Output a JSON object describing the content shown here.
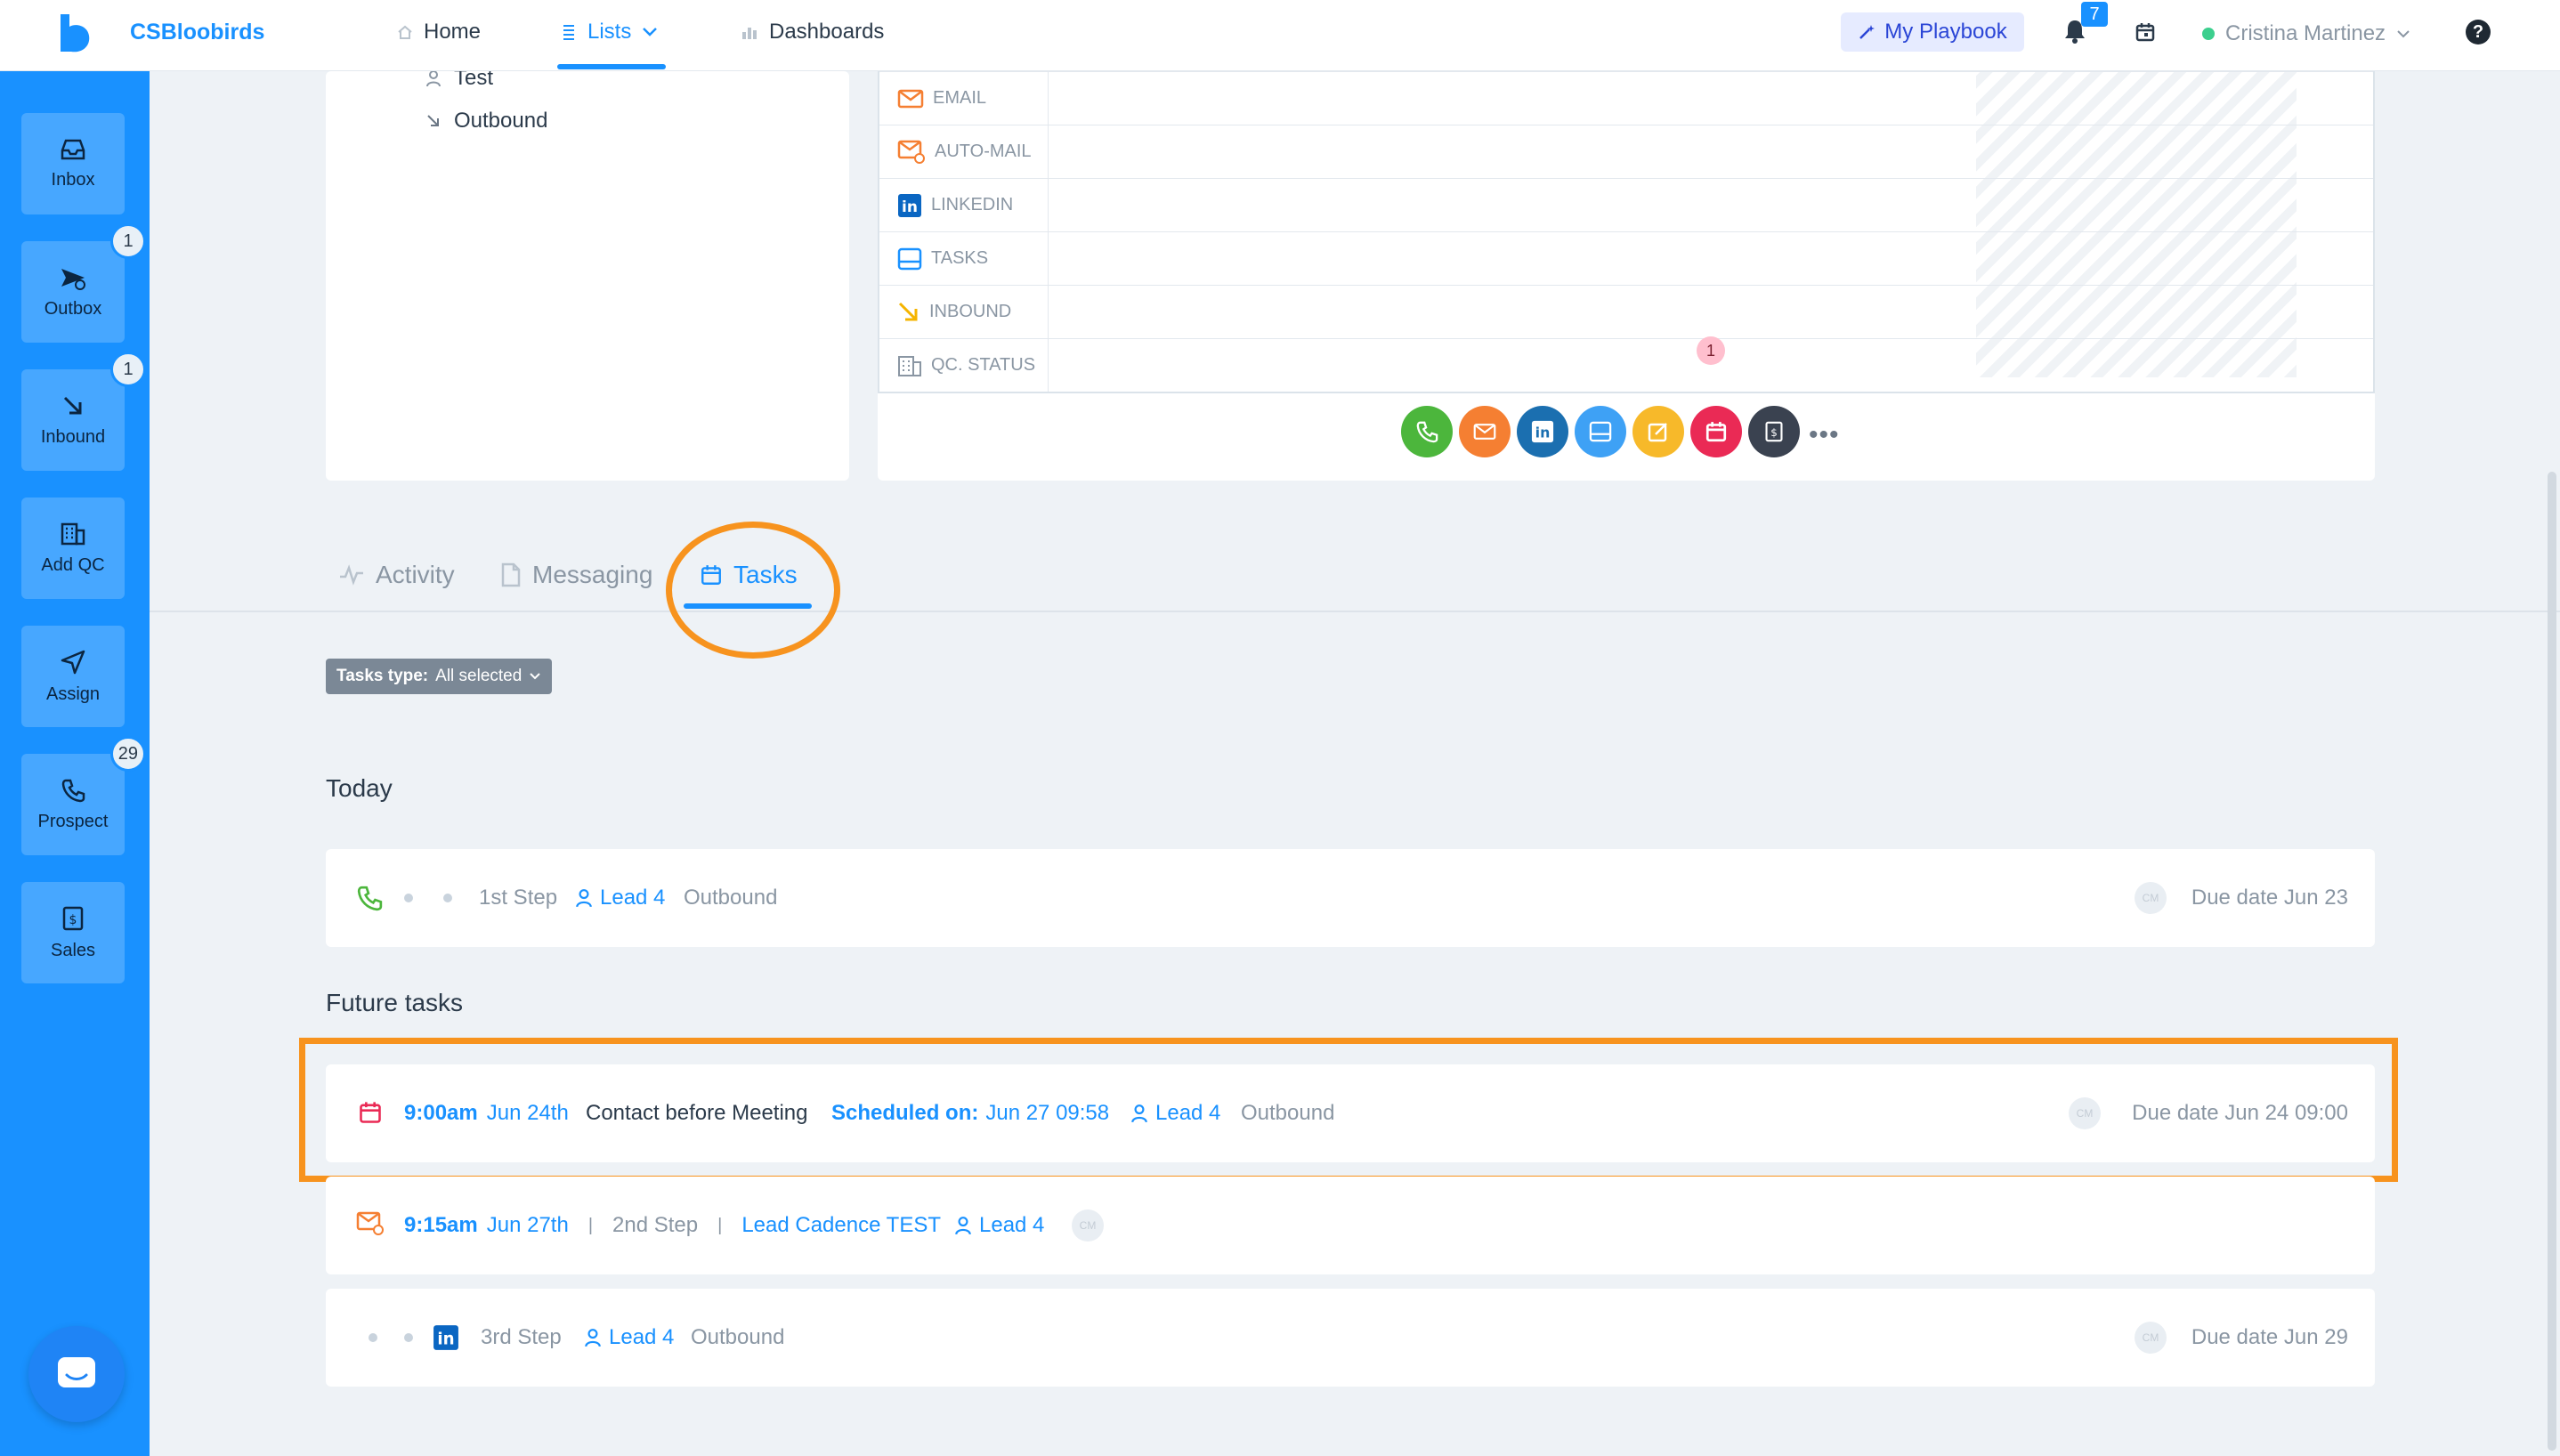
{
  "header": {
    "brand": "CSBloobirds",
    "nav": [
      {
        "label": "Home",
        "icon": "home-icon"
      },
      {
        "label": "Lists",
        "icon": "list-icon"
      },
      {
        "label": "Dashboards",
        "icon": "chart-icon"
      }
    ],
    "playbook": "My Playbook",
    "notifications_count": "7",
    "user_name": "Cristina Martinez",
    "help": "?"
  },
  "sidebar": {
    "items": [
      {
        "label": "Inbox",
        "badge": ""
      },
      {
        "label": "Outbox",
        "badge": "1"
      },
      {
        "label": "Inbound",
        "badge": "1"
      },
      {
        "label": "Add QC",
        "badge": ""
      },
      {
        "label": "Assign",
        "badge": ""
      },
      {
        "label": "Prospect",
        "badge": "29"
      },
      {
        "label": "Sales",
        "badge": ""
      }
    ]
  },
  "left_panel": {
    "items": [
      "Test",
      "Outbound"
    ]
  },
  "channels": {
    "rows": [
      "EMAIL",
      "AUTO-MAIL",
      "LINKEDIN",
      "TASKS",
      "INBOUND",
      "QC. STATUS"
    ],
    "qc_status_count": "1"
  },
  "action_bar": {
    "more": "•••",
    "colors": [
      "#4cb63c",
      "#f57f32",
      "#1b6fb0",
      "#3ea1f5",
      "#f7b92a",
      "#ea2a55",
      "#3a4250"
    ]
  },
  "tabs": [
    "Activity",
    "Messaging",
    "Tasks"
  ],
  "filter": {
    "label": "Tasks type:",
    "value": "All selected"
  },
  "today": {
    "title": "Today",
    "task": {
      "step": "1st Step",
      "lead": "Lead 4",
      "type": "Outbound",
      "avatar": "CM",
      "due": "Due date Jun 23"
    }
  },
  "future": {
    "title": "Future tasks",
    "tasks": [
      {
        "time": "9:00am",
        "date": "Jun 24th",
        "title": "Contact before Meeting",
        "scheduled_label": "Scheduled on:",
        "scheduled_value": "Jun 27 09:58",
        "lead": "Lead 4",
        "type": "Outbound",
        "avatar": "CM",
        "due": "Due date Jun 24 09:00"
      },
      {
        "time": "9:15am",
        "date": "Jun 27th",
        "step": "2nd Step",
        "cadence": "Lead Cadence TEST",
        "lead": "Lead 4",
        "avatar": "CM"
      },
      {
        "step": "3rd Step",
        "lead": "Lead 4",
        "type": "Outbound",
        "avatar": "CM",
        "due": "Due date Jun 29"
      }
    ]
  }
}
